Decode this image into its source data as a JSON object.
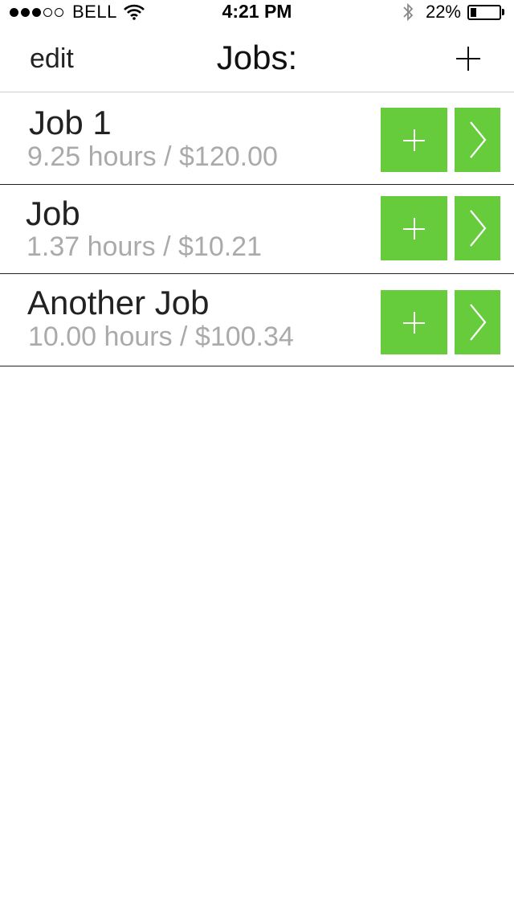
{
  "status_bar": {
    "signal": {
      "filled": 3,
      "empty": 2
    },
    "carrier": "BELL",
    "time": "4:21 PM",
    "battery_percent_label": "22%",
    "battery_level": 0.22,
    "icons": [
      "wifi-icon",
      "bluetooth-icon",
      "battery-icon"
    ]
  },
  "nav": {
    "edit_label": "edit",
    "title": "Jobs:",
    "add_icon": "plus-icon"
  },
  "jobs": [
    {
      "name": "Job 1",
      "summary": "9.25 hours / $120.00"
    },
    {
      "name": "Job",
      "summary": "1.37 hours / $10.21"
    },
    {
      "name": "Another Job",
      "summary": "10.00 hours / $100.34"
    }
  ],
  "colors": {
    "accent": "#66cc3c",
    "summary_text": "#aaaaaa",
    "divider": "#222222"
  }
}
